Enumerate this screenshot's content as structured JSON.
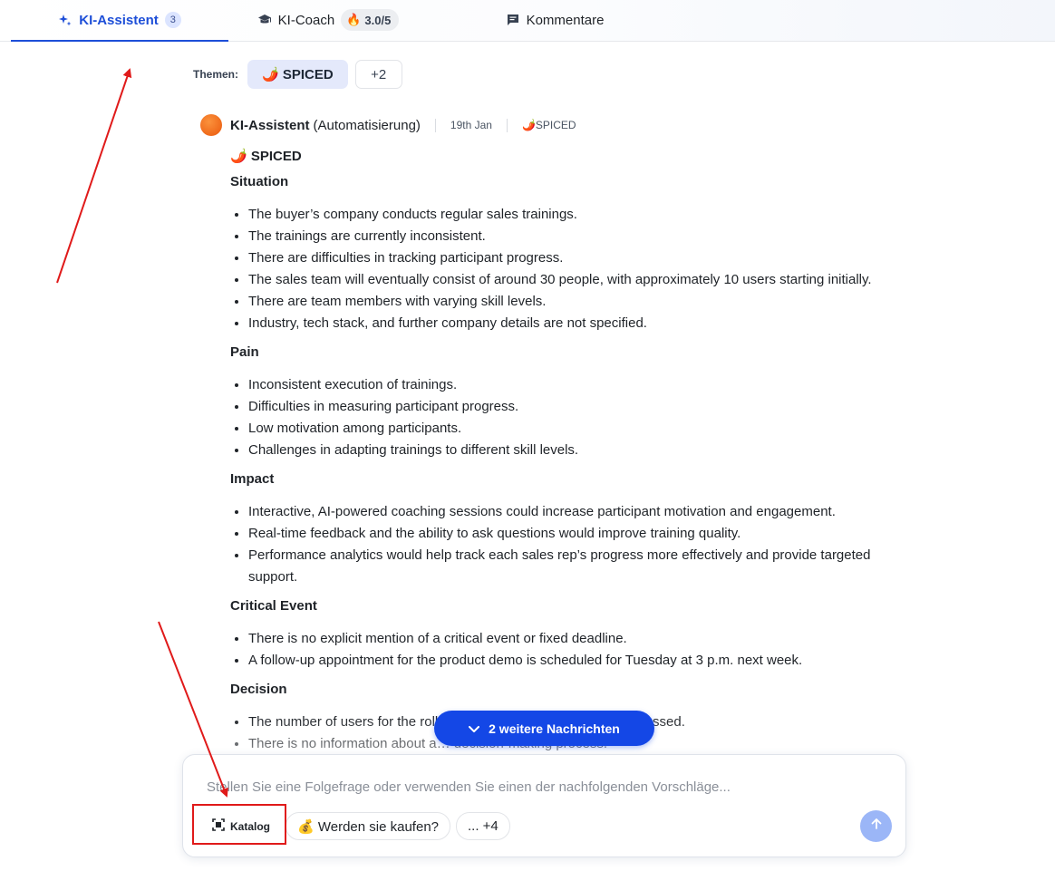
{
  "tabs": [
    {
      "label": "KI-Assistent",
      "badge": "3"
    },
    {
      "label": "KI-Coach",
      "score": "3.0/5"
    },
    {
      "label": "Kommentare"
    }
  ],
  "topics": {
    "label": "Themen:",
    "chip": "🌶️ SPICED",
    "more": "+2"
  },
  "message": {
    "author": "KI-Assistent",
    "role": "(Automatisierung)",
    "date": "19th Jan",
    "tag": "🌶️SPICED",
    "title": "🌶️ SPICED",
    "sections": [
      {
        "heading": "Situation",
        "items": [
          "The buyer’s company conducts regular sales trainings.",
          "The trainings are currently inconsistent.",
          "There are difficulties in tracking participant progress.",
          "The sales team will eventually consist of around 30 people, with approximately 10 users starting initially.",
          "There are team members with varying skill levels.",
          "Industry, tech stack, and further company details are not specified."
        ]
      },
      {
        "heading": "Pain",
        "items": [
          "Inconsistent execution of trainings.",
          "Difficulties in measuring participant progress.",
          "Low motivation among participants.",
          "Challenges in adapting trainings to different skill levels."
        ]
      },
      {
        "heading": "Impact",
        "items": [
          "Interactive, AI-powered coaching sessions could increase participant motivation and engagement.",
          "Real-time feedback and the ability to ask questions would improve training quality.",
          "Performance analytics would help track each sales rep’s progress more effectively and provide targeted support."
        ]
      },
      {
        "heading": "Critical Event",
        "items": [
          "There is no explicit mention of a critical event or fixed deadline.",
          "A follow-up appointment for the product demo is scheduled for Tuesday at 3 p.m. next week."
        ]
      },
      {
        "heading": "Decision",
        "items": [
          "The number of users for the roll… potential (approx. 30) were discussed.",
          "There is no information about a… decision-making process."
        ]
      }
    ]
  },
  "more_messages": "2 weitere Nachrichten",
  "composer": {
    "placeholder": "Stellen Sie eine Folgefrage oder verwenden Sie einen der nachfolgenden Vorschläge...",
    "suggestions": [
      "Katalog",
      "💰 Werden sie kaufen?",
      "... +4"
    ]
  },
  "colors": {
    "accent": "#1d4ed8",
    "button": "#1447e6",
    "annotation": "#e01a1a"
  }
}
